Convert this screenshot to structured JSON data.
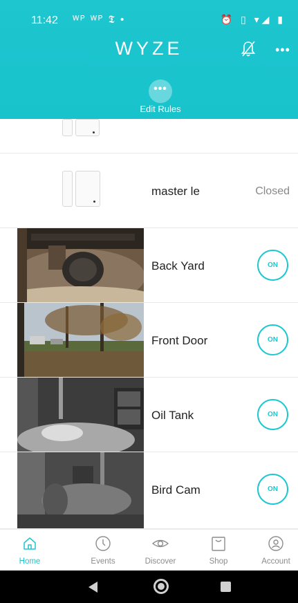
{
  "status_bar": {
    "time": "11:42",
    "notification_icons": "ᵂᴾ ᵂᴾ 𝕿 •",
    "right_icons": "⏰ ▯ ▾◢ ▮"
  },
  "header": {
    "logo": "WYZE",
    "more_label": "•••",
    "edit_rules_dots": "•••",
    "edit_rules_label": "Edit Rules",
    "accent_color": "#1ec6cf"
  },
  "devices": [
    {
      "name": "master le",
      "status": "Closed",
      "type": "contact-sensor"
    },
    {
      "name": "Back Yard",
      "toggle": "ON",
      "type": "camera"
    },
    {
      "name": "Front Door",
      "toggle": "ON",
      "type": "camera"
    },
    {
      "name": "Oil Tank",
      "toggle": "ON",
      "type": "camera"
    },
    {
      "name": "Bird Cam",
      "toggle": "ON",
      "type": "camera"
    }
  ],
  "bottom_nav": [
    {
      "label": "Home",
      "icon": "home-icon",
      "active": true
    },
    {
      "label": "Events",
      "icon": "clock-icon",
      "active": false
    },
    {
      "label": "Discover",
      "icon": "eye-icon",
      "active": false
    },
    {
      "label": "Shop",
      "icon": "shopping-bag-icon",
      "active": false
    },
    {
      "label": "Account",
      "icon": "account-icon",
      "active": false
    }
  ]
}
